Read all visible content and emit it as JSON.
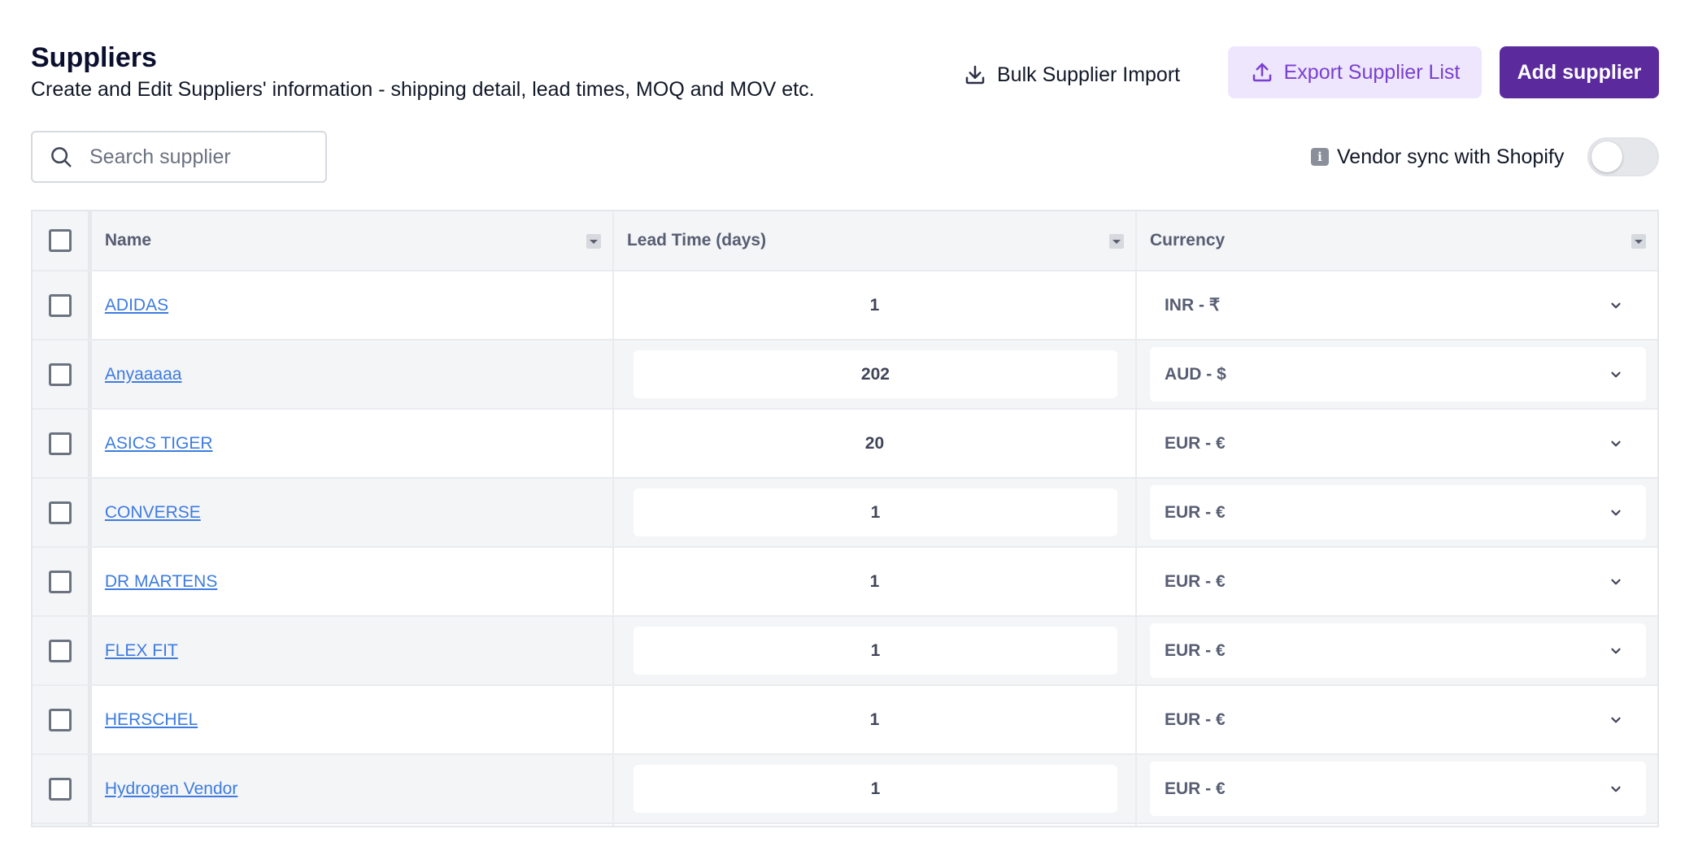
{
  "header": {
    "title": "Suppliers",
    "subtitle": "Create and Edit Suppliers' information - shipping detail, lead times, MOQ and MOV etc."
  },
  "toolbar": {
    "bulk_import_label": "Bulk Supplier Import",
    "export_label": "Export Supplier List",
    "add_label": "Add supplier"
  },
  "search": {
    "placeholder": "Search supplier",
    "value": ""
  },
  "vendor_sync": {
    "label": "Vendor sync with Shopify",
    "enabled": false,
    "info_icon": "info-icon"
  },
  "table": {
    "columns": [
      "Name",
      "Lead Time (days)",
      "Currency"
    ],
    "rows": [
      {
        "name": "ADIDAS",
        "lead_time": "1",
        "currency": "INR - ₹"
      },
      {
        "name": "Anyaaaaa",
        "lead_time": "202",
        "currency": "AUD - $"
      },
      {
        "name": "ASICS TIGER",
        "lead_time": "20",
        "currency": "EUR - €"
      },
      {
        "name": "CONVERSE",
        "lead_time": "1",
        "currency": "EUR - €"
      },
      {
        "name": "DR MARTENS",
        "lead_time": "1",
        "currency": "EUR - €"
      },
      {
        "name": "FLEX FIT",
        "lead_time": "1",
        "currency": "EUR - €"
      },
      {
        "name": "HERSCHEL",
        "lead_time": "1",
        "currency": "EUR - €"
      },
      {
        "name": "Hydrogen Vendor",
        "lead_time": "1",
        "currency": "EUR - €"
      }
    ]
  },
  "colors": {
    "accent": "#5b2b9e",
    "accent_light": "#ede6fd",
    "link": "#3d7be0"
  }
}
